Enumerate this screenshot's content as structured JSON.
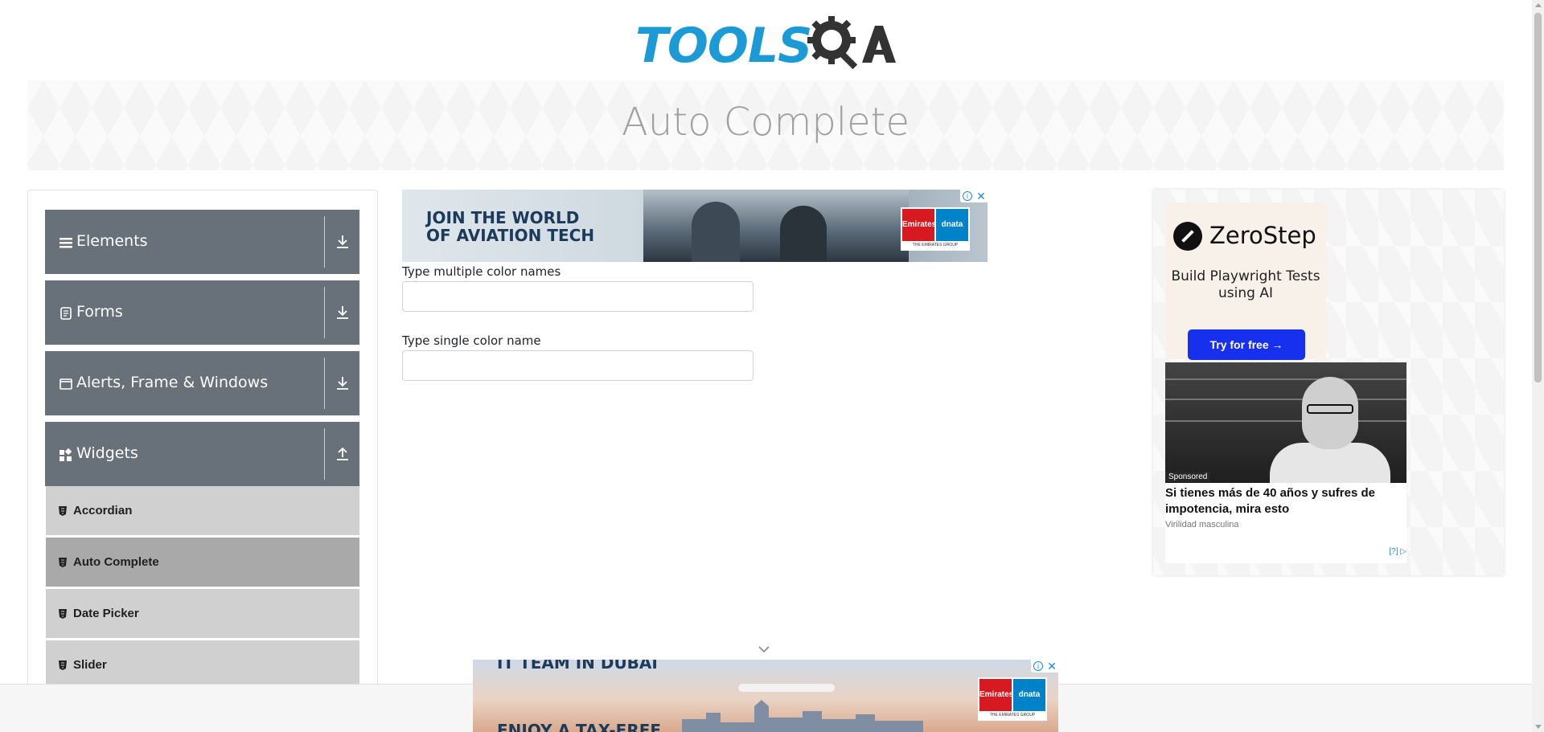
{
  "header": {
    "logo_text": "TOOLS",
    "logo_suffix": "QA",
    "logo_color": "#1c9ad6"
  },
  "banner": {
    "title": "Auto Complete"
  },
  "sidebar": {
    "groups": [
      {
        "label": "Elements",
        "icon": "hamburger-icon",
        "arrow": "download-arrow-icon"
      },
      {
        "label": "Forms",
        "icon": "document-icon",
        "arrow": "download-arrow-icon"
      },
      {
        "label": "Alerts, Frame & Windows",
        "icon": "window-icon",
        "arrow": "download-arrow-icon"
      },
      {
        "label": "Widgets",
        "icon": "widgets-icon",
        "arrow": "upload-arrow-icon"
      }
    ],
    "widget_items": [
      {
        "label": "Accordian",
        "active": false
      },
      {
        "label": "Auto Complete",
        "active": true
      },
      {
        "label": "Date Picker",
        "active": false
      },
      {
        "label": "Slider",
        "active": false
      }
    ],
    "group_color": "#687079",
    "active_item_color": "#a9a9a9"
  },
  "ads": {
    "top": {
      "line1": "JOIN THE WORLD",
      "line2": "OF AVIATION TECH",
      "brand1": "Emirates",
      "brand2": "dnata",
      "brand_sub": "THE EMIRATES GROUP"
    },
    "bottom": {
      "line1": "IT TEAM IN DUBAI",
      "line2": "ENJOY A TAX-FREE",
      "brand1": "Emirates",
      "brand2": "dnata",
      "brand_sub": "THE EMIRATES GROUP"
    },
    "right": {
      "brand": "ZeroStep",
      "tagline": "Build Playwright Tests using AI",
      "cta": "Try for free →",
      "cta_color": "#1730ee",
      "sponsored_badge": "Sponsored",
      "sponsored_title": "Si tienes más de 40 años y sufres de impotencia, mira esto",
      "sponsored_source": "Virilidad masculina",
      "adchoice": "[?]"
    },
    "controls": {
      "info": "i",
      "close": "✕"
    }
  },
  "form": {
    "multiple_label": "Type multiple color names",
    "multiple_value": "",
    "single_label": "Type single color name",
    "single_value": ""
  }
}
